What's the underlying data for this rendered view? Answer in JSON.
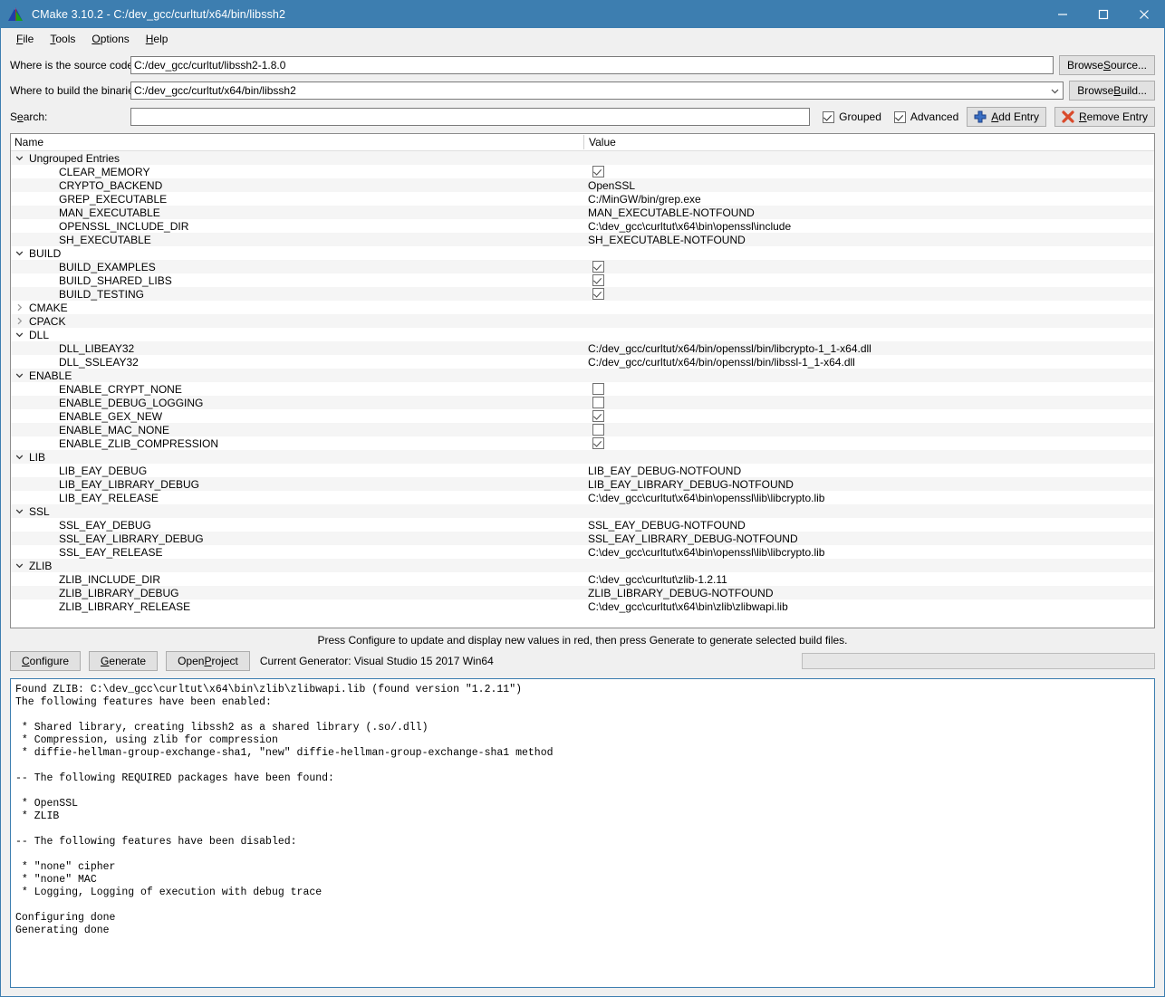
{
  "window": {
    "title": "CMake 3.10.2 - C:/dev_gcc/curltut/x64/bin/libssh2",
    "logo_icon": "cmake-triangle-logo",
    "minimize_icon": "minimize-icon",
    "maximize_icon": "maximize-icon",
    "close_icon": "close-icon",
    "titlebar_color": "#3d7eb0"
  },
  "menubar": {
    "items": [
      {
        "label": "File",
        "mnemonic": "F"
      },
      {
        "label": "Tools",
        "mnemonic": "T"
      },
      {
        "label": "Options",
        "mnemonic": "O"
      },
      {
        "label": "Help",
        "mnemonic": "H"
      }
    ]
  },
  "paths": {
    "source_label": "Where is the source code:",
    "source_value": "C:/dev_gcc/curltut/libssh2-1.8.0",
    "browse_source_label": "Browse Source...",
    "browse_source_mnemonic": "S",
    "build_label": "Where to build the binaries:",
    "build_value": "C:/dev_gcc/curltut/x64/bin/libssh2",
    "browse_build_label": "Browse Build...",
    "browse_build_mnemonic": "B"
  },
  "search": {
    "label": "Search:",
    "mnemonic": "e",
    "value": "",
    "placeholder": ""
  },
  "options": {
    "grouped_label": "Grouped",
    "grouped_checked": true,
    "advanced_label": "Advanced",
    "advanced_checked": true,
    "add_entry_label": "Add Entry",
    "add_entry_mnemonic": "A",
    "add_entry_icon": "plus-icon",
    "remove_entry_label": "Remove Entry",
    "remove_entry_mnemonic": "R",
    "remove_entry_icon": "red-x-icon"
  },
  "table": {
    "columns": [
      "Name",
      "Value"
    ],
    "rows": [
      {
        "type": "group",
        "name": "Ungrouped Entries",
        "expanded": true,
        "value": null
      },
      {
        "type": "entry",
        "name": "CLEAR_MEMORY",
        "value_type": "bool",
        "checked": true
      },
      {
        "type": "entry",
        "name": "CRYPTO_BACKEND",
        "value_type": "text",
        "value": "OpenSSL"
      },
      {
        "type": "entry",
        "name": "GREP_EXECUTABLE",
        "value_type": "text",
        "value": "C:/MinGW/bin/grep.exe"
      },
      {
        "type": "entry",
        "name": "MAN_EXECUTABLE",
        "value_type": "text",
        "value": "MAN_EXECUTABLE-NOTFOUND"
      },
      {
        "type": "entry",
        "name": "OPENSSL_INCLUDE_DIR",
        "value_type": "text",
        "value": "C:\\dev_gcc\\curltut\\x64\\bin\\openssl\\include"
      },
      {
        "type": "entry",
        "name": "SH_EXECUTABLE",
        "value_type": "text",
        "value": "SH_EXECUTABLE-NOTFOUND"
      },
      {
        "type": "group",
        "name": "BUILD",
        "expanded": true,
        "value": null
      },
      {
        "type": "entry",
        "name": "BUILD_EXAMPLES",
        "value_type": "bool",
        "checked": true
      },
      {
        "type": "entry",
        "name": "BUILD_SHARED_LIBS",
        "value_type": "bool",
        "checked": true
      },
      {
        "type": "entry",
        "name": "BUILD_TESTING",
        "value_type": "bool",
        "checked": true
      },
      {
        "type": "group",
        "name": "CMAKE",
        "expanded": false,
        "value": null
      },
      {
        "type": "group",
        "name": "CPACK",
        "expanded": false,
        "value": null
      },
      {
        "type": "group",
        "name": "DLL",
        "expanded": true,
        "value": null
      },
      {
        "type": "entry",
        "name": "DLL_LIBEAY32",
        "value_type": "text",
        "value": "C:/dev_gcc/curltut/x64/bin/openssl/bin/libcrypto-1_1-x64.dll"
      },
      {
        "type": "entry",
        "name": "DLL_SSLEAY32",
        "value_type": "text",
        "value": "C:/dev_gcc/curltut/x64/bin/openssl/bin/libssl-1_1-x64.dll"
      },
      {
        "type": "group",
        "name": "ENABLE",
        "expanded": true,
        "value": null
      },
      {
        "type": "entry",
        "name": "ENABLE_CRYPT_NONE",
        "value_type": "bool",
        "checked": false
      },
      {
        "type": "entry",
        "name": "ENABLE_DEBUG_LOGGING",
        "value_type": "bool",
        "checked": false
      },
      {
        "type": "entry",
        "name": "ENABLE_GEX_NEW",
        "value_type": "bool",
        "checked": true
      },
      {
        "type": "entry",
        "name": "ENABLE_MAC_NONE",
        "value_type": "bool",
        "checked": false
      },
      {
        "type": "entry",
        "name": "ENABLE_ZLIB_COMPRESSION",
        "value_type": "bool",
        "checked": true
      },
      {
        "type": "group",
        "name": "LIB",
        "expanded": true,
        "value": null
      },
      {
        "type": "entry",
        "name": "LIB_EAY_DEBUG",
        "value_type": "text",
        "value": "LIB_EAY_DEBUG-NOTFOUND"
      },
      {
        "type": "entry",
        "name": "LIB_EAY_LIBRARY_DEBUG",
        "value_type": "text",
        "value": "LIB_EAY_LIBRARY_DEBUG-NOTFOUND"
      },
      {
        "type": "entry",
        "name": "LIB_EAY_RELEASE",
        "value_type": "text",
        "value": "C:\\dev_gcc\\curltut\\x64\\bin\\openssl\\lib\\libcrypto.lib"
      },
      {
        "type": "group",
        "name": "SSL",
        "expanded": true,
        "value": null
      },
      {
        "type": "entry",
        "name": "SSL_EAY_DEBUG",
        "value_type": "text",
        "value": "SSL_EAY_DEBUG-NOTFOUND"
      },
      {
        "type": "entry",
        "name": "SSL_EAY_LIBRARY_DEBUG",
        "value_type": "text",
        "value": "SSL_EAY_LIBRARY_DEBUG-NOTFOUND"
      },
      {
        "type": "entry",
        "name": "SSL_EAY_RELEASE",
        "value_type": "text",
        "value": "C:\\dev_gcc\\curltut\\x64\\bin\\openssl\\lib\\libcrypto.lib"
      },
      {
        "type": "group",
        "name": "ZLIB",
        "expanded": true,
        "value": null
      },
      {
        "type": "entry",
        "name": "ZLIB_INCLUDE_DIR",
        "value_type": "text",
        "value": "C:\\dev_gcc\\curltut\\zlib-1.2.11"
      },
      {
        "type": "entry",
        "name": "ZLIB_LIBRARY_DEBUG",
        "value_type": "text",
        "value": "ZLIB_LIBRARY_DEBUG-NOTFOUND"
      },
      {
        "type": "entry",
        "name": "ZLIB_LIBRARY_RELEASE",
        "value_type": "text",
        "value": "C:\\dev_gcc\\curltut\\x64\\bin\\zlib\\zlibwapi.lib"
      }
    ]
  },
  "hint": "Press Configure to update and display new values in red, then press Generate to generate selected build files.",
  "actions": {
    "configure_label": "Configure",
    "configure_mnemonic": "C",
    "generate_label": "Generate",
    "generate_mnemonic": "G",
    "open_project_label": "Open Project",
    "open_project_mnemonic": "P",
    "generator_status": "Current Generator: Visual Studio 15 2017 Win64",
    "progress_value": 0
  },
  "output": {
    "text": "Found ZLIB: C:\\dev_gcc\\curltut\\x64\\bin\\zlib\\zlibwapi.lib (found version \"1.2.11\")\nThe following features have been enabled:\n\n * Shared library, creating libssh2 as a shared library (.so/.dll)\n * Compression, using zlib for compression\n * diffie-hellman-group-exchange-sha1, \"new\" diffie-hellman-group-exchange-sha1 method\n\n-- The following REQUIRED packages have been found:\n\n * OpenSSL\n * ZLIB\n\n-- The following features have been disabled:\n\n * \"none\" cipher\n * \"none\" MAC\n * Logging, Logging of execution with debug trace\n\nConfiguring done\nGenerating done"
  }
}
